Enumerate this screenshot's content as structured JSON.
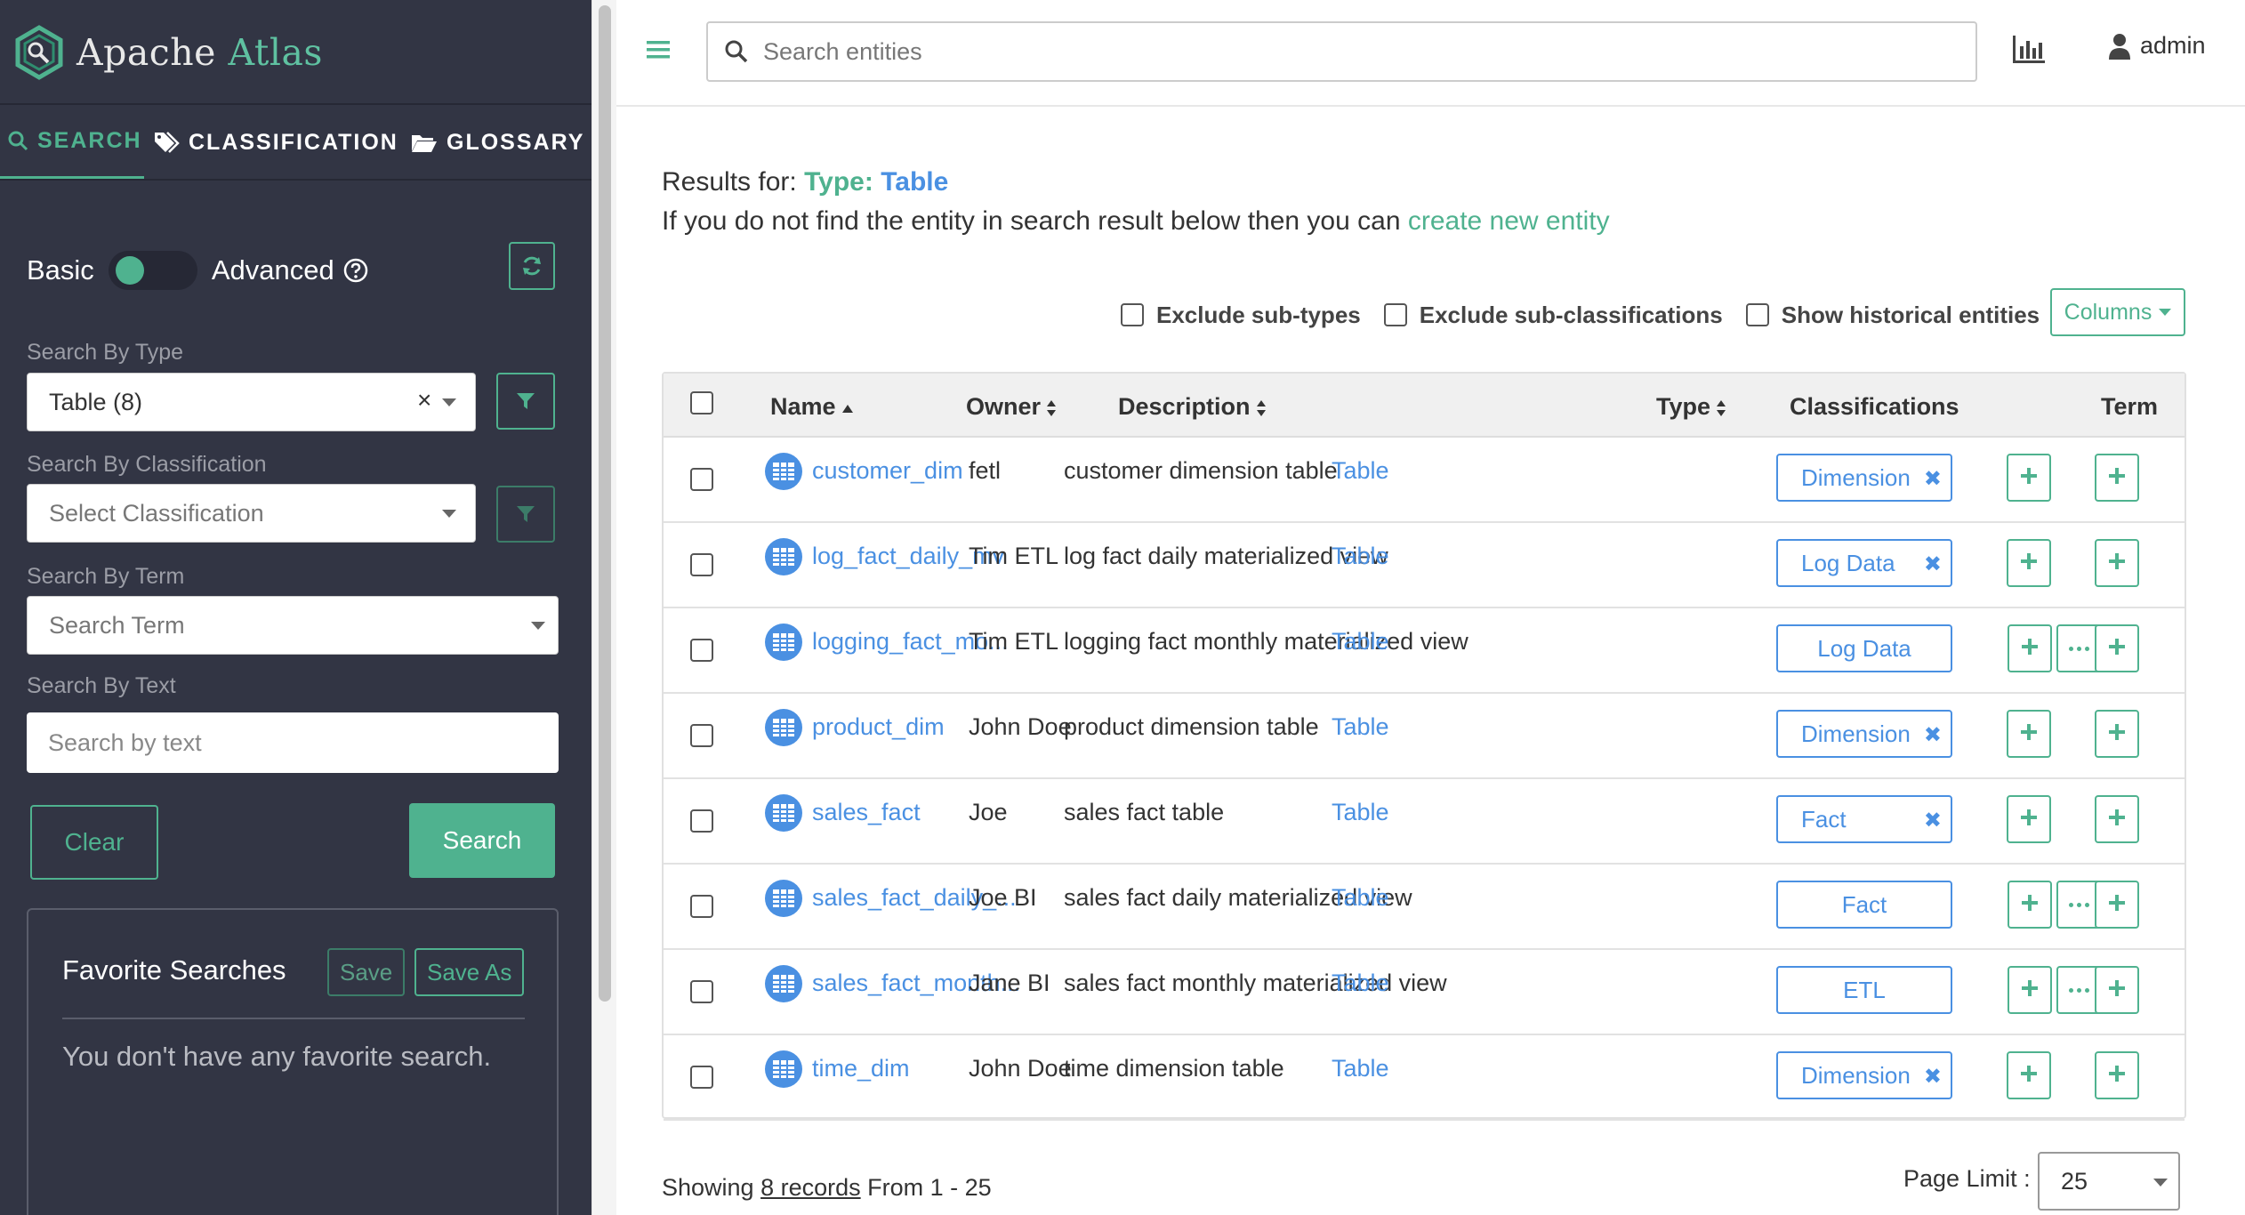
{
  "brand": {
    "word1": "Apache",
    "word2": "Atlas"
  },
  "sidebar": {
    "tabs": [
      {
        "label": "SEARCH",
        "icon": "search-icon",
        "active": true
      },
      {
        "label": "CLASSIFICATION",
        "icon": "tags-icon",
        "active": false
      },
      {
        "label": "GLOSSARY",
        "icon": "folder-open-icon",
        "active": false
      }
    ],
    "mode": {
      "basic": "Basic",
      "advanced": "Advanced"
    },
    "type": {
      "label": "Search By Type",
      "value": "Table (8)",
      "clear": "×"
    },
    "classification": {
      "label": "Search By Classification",
      "placeholder": "Select Classification"
    },
    "term": {
      "label": "Search By Term",
      "placeholder": "Search Term"
    },
    "text": {
      "label": "Search By Text",
      "placeholder": "Search by text"
    },
    "clear_label": "Clear",
    "search_label": "Search",
    "favorites": {
      "title": "Favorite Searches",
      "save": "Save",
      "save_as": "Save As",
      "empty": "You don't have any favorite search."
    }
  },
  "header": {
    "search_placeholder": "Search entities",
    "user": "admin"
  },
  "results": {
    "prefix": "Results for: ",
    "type_key": "Type:",
    "type_value": "Table",
    "notfound": "If you do not find the entity in search result below then you can ",
    "create_link": "create new entity"
  },
  "options": {
    "exclude_subtypes": "Exclude sub-types",
    "exclude_subclass": "Exclude sub-classifications",
    "show_historical": "Show historical entities",
    "columns": "Columns"
  },
  "table": {
    "headers": {
      "name": "Name",
      "owner": "Owner",
      "description": "Description",
      "type": "Type",
      "classifications": "Classifications",
      "term": "Term"
    },
    "rows": [
      {
        "name": "customer_dim",
        "owner": "fetl",
        "description": "customer dimension table",
        "type": "Table",
        "tag": "Dimension",
        "removable": true,
        "more": false
      },
      {
        "name": "log_fact_daily_mv",
        "owner": "Tim ETL",
        "description": "log fact daily materialized view",
        "type": "Table",
        "tag": "Log Data",
        "removable": true,
        "more": false
      },
      {
        "name": "logging_fact_mo...",
        "owner": "Tim ETL",
        "description": "logging fact monthly materialized view",
        "type": "Table",
        "tag": "Log Data",
        "removable": false,
        "more": true
      },
      {
        "name": "product_dim",
        "owner": "John Doe",
        "description": "product dimension table",
        "type": "Table",
        "tag": "Dimension",
        "removable": true,
        "more": false
      },
      {
        "name": "sales_fact",
        "owner": "Joe",
        "description": "sales fact table",
        "type": "Table",
        "tag": "Fact",
        "removable": true,
        "more": false
      },
      {
        "name": "sales_fact_daily_...",
        "owner": "Joe BI",
        "description": "sales fact daily materialized view",
        "type": "Table",
        "tag": "Fact",
        "removable": false,
        "more": true
      },
      {
        "name": "sales_fact_month...",
        "owner": "Jane BI",
        "description": "sales fact monthly materialized view",
        "type": "Table",
        "tag": "ETL",
        "removable": false,
        "more": true
      },
      {
        "name": "time_dim",
        "owner": "John Doe",
        "description": "time dimension table",
        "type": "Table",
        "tag": "Dimension",
        "removable": true,
        "more": false
      }
    ]
  },
  "footer": {
    "showing": "Showing ",
    "records": "8 records",
    "range": " From 1 - 25",
    "page_limit_label": "Page Limit :",
    "page_limit": "25"
  },
  "colors": {
    "accent": "#4fb28f",
    "link": "#4a90e2",
    "sidebar": "#323544"
  }
}
